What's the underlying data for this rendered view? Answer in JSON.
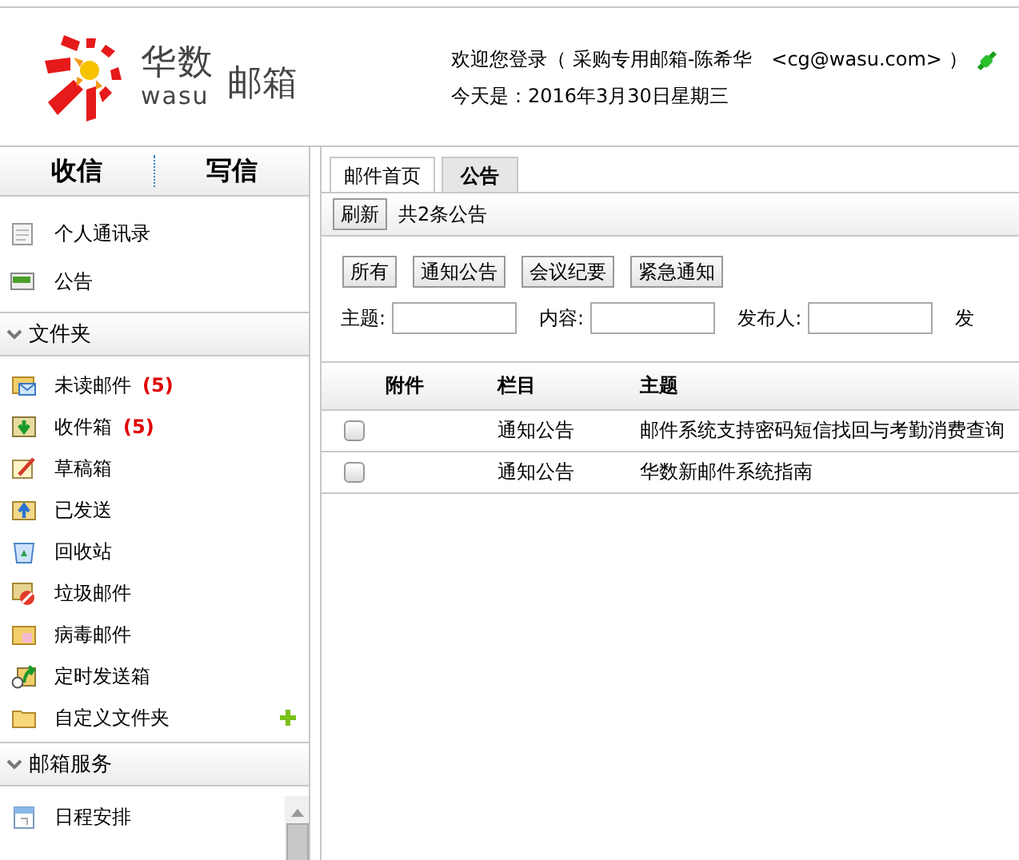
{
  "header": {
    "logo_cn": "华数",
    "logo_en": "wasu",
    "logo_product": "邮箱",
    "welcome": "欢迎您登录（ 采购专用邮箱-陈希华　<cg@wasu.com> ）",
    "date": "今天是：2016年3月30日星期三"
  },
  "sidebar": {
    "tabs": [
      {
        "label": "收信"
      },
      {
        "label": "写信"
      }
    ],
    "top_items": [
      {
        "label": "个人通讯录"
      },
      {
        "label": "公告"
      }
    ],
    "sections": [
      {
        "title": "文件夹",
        "expanded": true,
        "items": [
          {
            "label": "未读邮件",
            "count": "(5)"
          },
          {
            "label": "收件箱",
            "count": "(5)"
          },
          {
            "label": "草稿箱"
          },
          {
            "label": "已发送"
          },
          {
            "label": "回收站"
          },
          {
            "label": "垃圾邮件"
          },
          {
            "label": "病毒邮件"
          },
          {
            "label": "定时发送箱"
          },
          {
            "label": "自定义文件夹",
            "addable": true
          }
        ]
      },
      {
        "title": "邮箱服务",
        "expanded": true,
        "items": [
          {
            "label": "日程安排"
          }
        ]
      }
    ]
  },
  "main": {
    "tabs": [
      {
        "label": "邮件首页",
        "selected": false
      },
      {
        "label": "公告",
        "selected": true
      }
    ],
    "toolbar": {
      "refresh": "刷新",
      "summary": "共2条公告"
    },
    "filters": [
      "所有",
      "通知公告",
      "会议纪要",
      "紧急通知"
    ],
    "search_fields": [
      {
        "label": "主题:"
      },
      {
        "label": "内容:"
      },
      {
        "label": "发布人:"
      },
      {
        "label": "发"
      }
    ],
    "table": {
      "columns": [
        "附件",
        "栏目",
        "主题"
      ],
      "rows": [
        {
          "checked": false,
          "column": "通知公告",
          "subject": "邮件系统支持密码短信找回与考勤消费查询"
        },
        {
          "checked": false,
          "column": "通知公告",
          "subject": "华数新邮件系统指南"
        }
      ]
    }
  }
}
